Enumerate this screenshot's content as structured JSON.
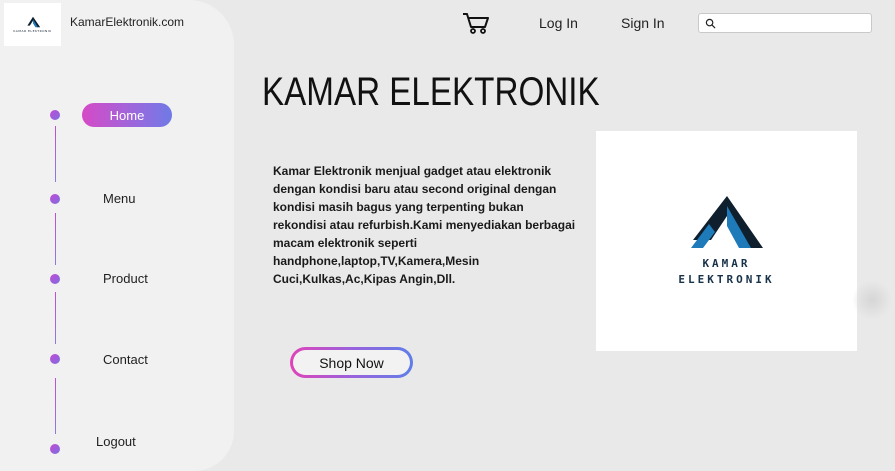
{
  "site": {
    "logo_text": "KAMAR ELEKTRONIK",
    "name": "KamarElektronik.com"
  },
  "header": {
    "login_label": "Log In",
    "signup_label": "Sign In",
    "search_placeholder": "",
    "search_value": ""
  },
  "sidebar": {
    "items": [
      {
        "label": "Home",
        "active": true
      },
      {
        "label": "Menu",
        "active": false
      },
      {
        "label": "Product",
        "active": false
      },
      {
        "label": "Contact",
        "active": false
      },
      {
        "label": "Logout",
        "active": false
      }
    ]
  },
  "main": {
    "title": "KAMAR ELEKTRONIK",
    "description": "Kamar Elektronik menjual gadget atau elektronik dengan kondisi baru atau second original dengan kondisi masih bagus yang terpenting bukan rekondisi atau refurbish.Kami menyediakan berbagai macam elektronik seperti handphone,laptop,TV,Kamera,Mesin Cuci,Kulkas,Ac,Kipas Angin,Dll.",
    "shop_button": "Shop Now",
    "brand_line1": "KAMAR",
    "brand_line2": "ELEKTRONIK"
  },
  "colors": {
    "accent_pink": "#d64ac7",
    "accent_blue": "#6f7ae6",
    "logo_blue": "#1e7ab8",
    "logo_dark": "#0f1f2e"
  },
  "icons": {
    "cart": "cart-icon",
    "search": "search-icon",
    "logo": "logo-icon"
  }
}
